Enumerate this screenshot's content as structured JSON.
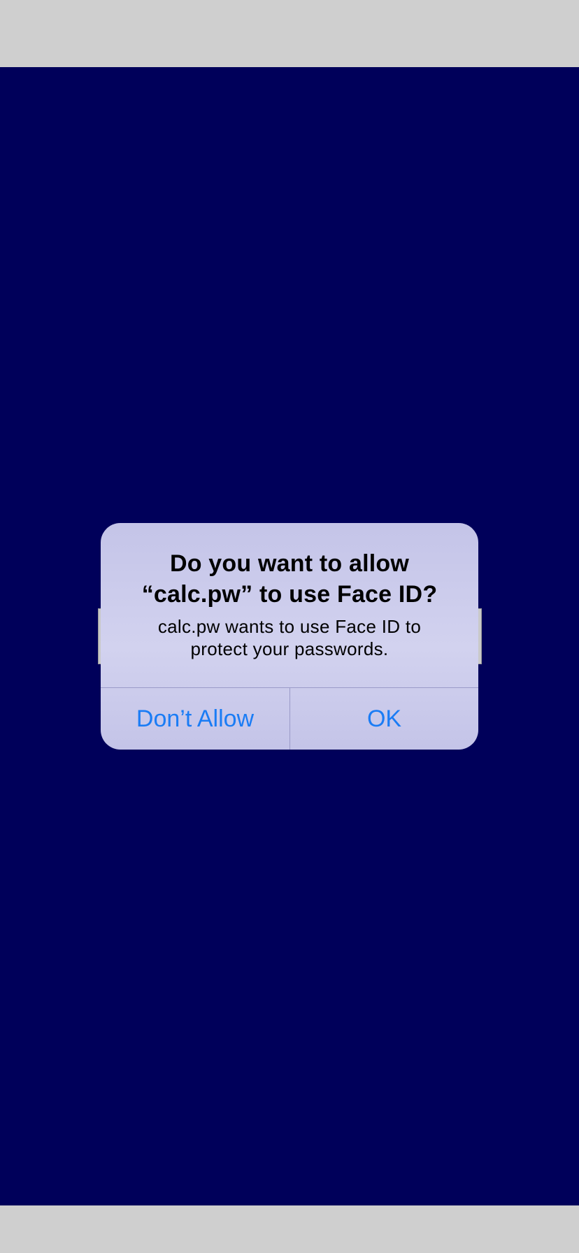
{
  "alert": {
    "title_line1": "Do you want to allow",
    "title_line2": "“calc.pw” to use Face ID?",
    "message_line1": "calc.pw wants to use Face ID to",
    "message_line2": "protect your passwords.",
    "buttons": [
      {
        "label": "Don’t Allow"
      },
      {
        "label": "OK"
      }
    ]
  },
  "colors": {
    "background": "#00005a",
    "outer_bars": "#cfcfcf",
    "alert_fill": "#d2d2ef",
    "button_text": "#1a7cf5"
  }
}
